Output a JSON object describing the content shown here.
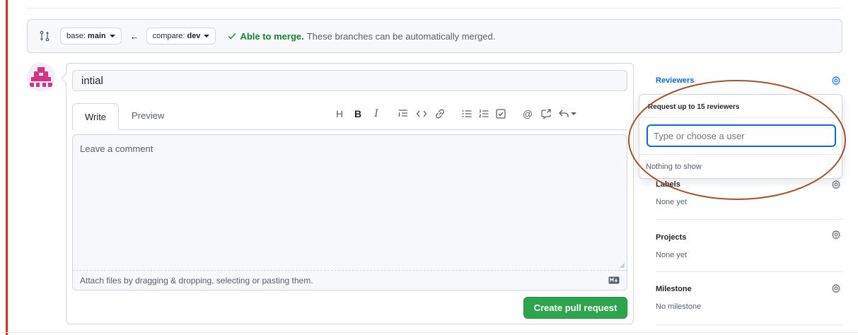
{
  "compare": {
    "base_prefix": "base:",
    "base_branch": "main",
    "compare_prefix": "compare:",
    "compare_branch": "dev",
    "arrow": "←",
    "merge_ok": "Able to merge.",
    "merge_desc": "These branches can be automatically merged."
  },
  "form": {
    "title_value": "intial",
    "tabs": [
      {
        "label": "Write"
      },
      {
        "label": "Preview"
      }
    ],
    "comment_placeholder": "Leave a comment",
    "attach_hint": "Attach files by dragging & dropping, selecting or pasting them.",
    "submit_label": "Create pull request"
  },
  "toolbar": {
    "heading": "H",
    "bold": "B",
    "italic": "I",
    "mention": "@"
  },
  "sidebar": {
    "reviewers": {
      "title": "Reviewers",
      "dropdown_header": "Request up to 15 reviewers",
      "input_placeholder": "Type or choose a user",
      "empty_text": "Nothing to show"
    },
    "labels": {
      "title": "Labels",
      "value": "None yet"
    },
    "projects": {
      "title": "Projects",
      "value": "None yet"
    },
    "milestone": {
      "title": "Milestone",
      "value": "No milestone"
    }
  },
  "colors": {
    "accent_blue": "#0969da",
    "success_green": "#1a7f37",
    "button_green": "#2da44e",
    "annotation_brown": "#a0522d",
    "avatar_magenta": "#d63384"
  },
  "icons": {
    "compare": "git-compare-icon",
    "merge_status": "check-icon",
    "gear": "gear-icon",
    "markdown": "markdown-icon"
  }
}
